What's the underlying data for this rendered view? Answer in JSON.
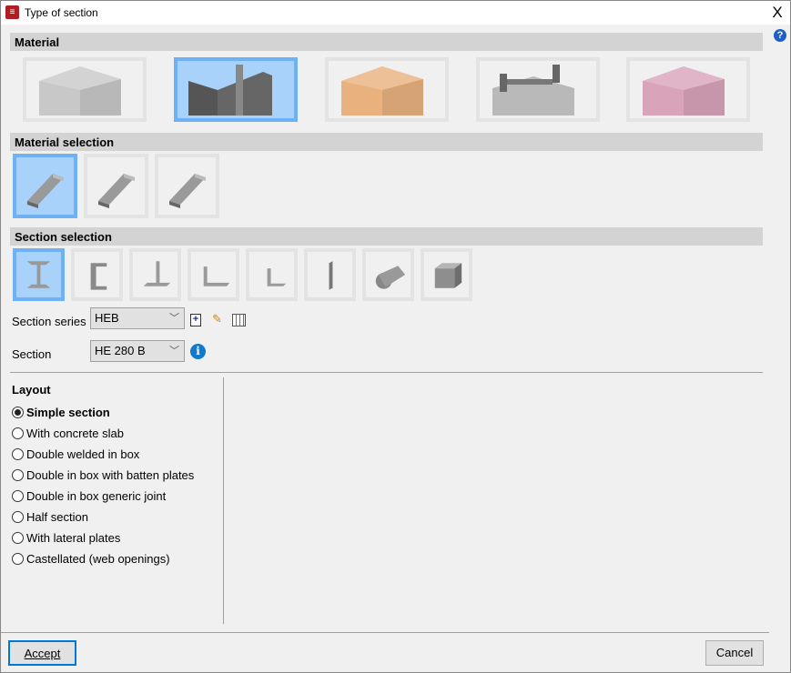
{
  "window": {
    "title": "Type of section",
    "close": "X",
    "help": "?"
  },
  "material": {
    "header": "Material",
    "selected": 1,
    "items": [
      {
        "name": "concrete",
        "color": "#c8c8c8"
      },
      {
        "name": "steel",
        "color": "#555555"
      },
      {
        "name": "timber",
        "color": "#e9b17e"
      },
      {
        "name": "composite",
        "color": "#b9b9b9"
      },
      {
        "name": "generic",
        "color": "#d9a3b9"
      }
    ]
  },
  "material_selection": {
    "header": "Material selection",
    "selected": 0,
    "items": [
      "rolled",
      "welded",
      "cold-formed"
    ]
  },
  "section_selection": {
    "header": "Section selection",
    "selected": 0,
    "items": [
      "i-section",
      "channel",
      "tee",
      "angle",
      "small-angle",
      "plate",
      "round-bar",
      "box"
    ]
  },
  "series": {
    "label": "Section series",
    "value": "HEB"
  },
  "section": {
    "label": "Section",
    "value": "HE 280 B"
  },
  "layout": {
    "title": "Layout",
    "selected": 0,
    "options": [
      "Simple section",
      "With concrete slab",
      "Double welded in box",
      "Double in box with batten plates",
      "Double in box generic joint",
      "Half section",
      "With lateral plates",
      "Castellated (web openings)"
    ]
  },
  "buttons": {
    "accept": "Accept",
    "cancel": "Cancel"
  }
}
